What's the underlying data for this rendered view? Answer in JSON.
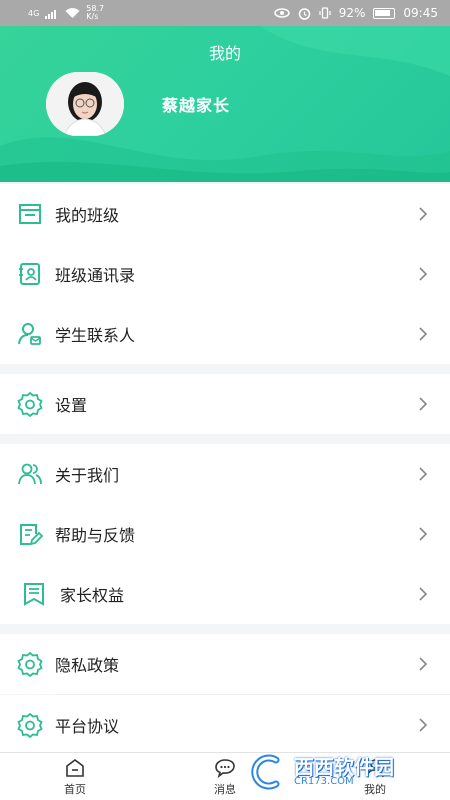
{
  "status_bar": {
    "network": "4G",
    "speed_value": "58.7",
    "speed_unit": "K/s",
    "battery": "92%",
    "time": "09:45"
  },
  "header": {
    "title": "我的",
    "user_name": "蔡越家长"
  },
  "menu": {
    "items": [
      {
        "label": "我的班级",
        "icon": "class-board-icon"
      },
      {
        "label": "班级通讯录",
        "icon": "contacts-book-icon"
      },
      {
        "label": "学生联系人",
        "icon": "person-contact-icon"
      },
      {
        "label": "设置",
        "icon": "gear-icon"
      },
      {
        "label": "关于我们",
        "icon": "people-group-icon"
      },
      {
        "label": "帮助与反馈",
        "icon": "feedback-edit-icon"
      },
      {
        "label": "家长权益",
        "icon": "bookmark-doc-icon"
      },
      {
        "label": "隐私政策",
        "icon": "gear-icon"
      },
      {
        "label": "平台协议",
        "icon": "gear-icon"
      }
    ]
  },
  "bottom_nav": {
    "home": "首页",
    "messages": "消息",
    "mine": "我的"
  },
  "watermark": {
    "main": "西西软件园",
    "sub": "CR173.COM"
  },
  "colors": {
    "accent": "#2dcf9e",
    "icon": "#2dbd93"
  }
}
